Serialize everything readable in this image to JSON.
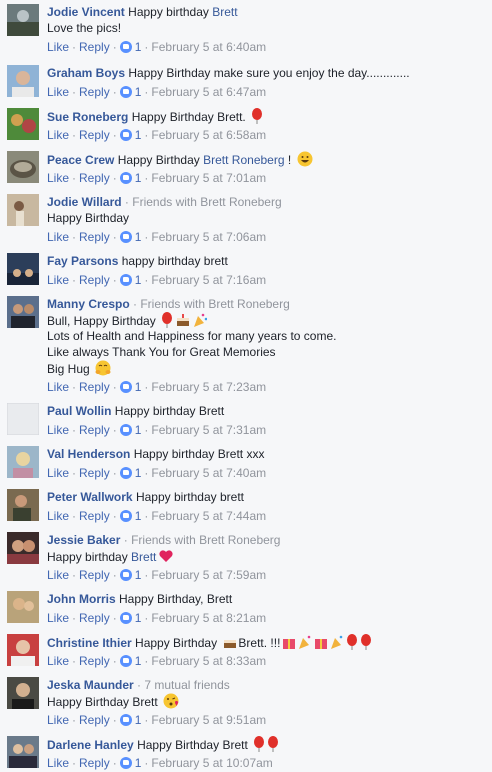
{
  "labels": {
    "like": "Like",
    "reply": "Reply",
    "separator": "·"
  },
  "colors": {
    "link": "#365899",
    "meta": "#90949c",
    "background": "#f6f7f9"
  },
  "comments": [
    {
      "author": "Jodie Vincent",
      "lines": [
        "Love the pics!"
      ],
      "inline_text": "Happy birthday ",
      "inline_mention": "Brett",
      "likes": "1",
      "time": "February 5 at 6:40am"
    },
    {
      "author": "Graham Boys",
      "inline_text": "Happy Birthday make sure you enjoy the day.............",
      "likes": "1",
      "time": "February 5 at 6:47am"
    },
    {
      "author": "Sue Roneberg",
      "inline_text": "Happy Birthday Brett. ",
      "emojis": [
        "balloon-emoji"
      ],
      "likes": "1",
      "time": "February 5 at 6:58am"
    },
    {
      "author": "Peace Crew",
      "inline_text": "Happy Birthday ",
      "inline_mention": "Brett Roneberg",
      "inline_suffix": " ! ",
      "emojis": [
        "grinning-emoji"
      ],
      "likes": "1",
      "time": "February 5 at 7:01am"
    },
    {
      "author": "Jodie Willard",
      "meta": " · Friends with Brett Roneberg",
      "lines": [
        "Happy Birthday"
      ],
      "likes": "1",
      "time": "February 5 at 7:06am"
    },
    {
      "author": "Fay Parsons",
      "inline_text": "happy birthday brett",
      "likes": "1",
      "time": "February 5 at 7:16am"
    },
    {
      "author": "Manny Crespo",
      "meta": " · Friends with Brett Roneberg",
      "lines": [
        "Bull, Happy Birthday ",
        "Lots of Health and Happiness for many years to come.",
        "Like always Thank You for Great Memories",
        "Big Hug "
      ],
      "likes": "1",
      "time": "February 5 at 7:23am"
    },
    {
      "author": "Paul Wollin",
      "inline_text": "Happy birthday Brett",
      "likes": "1",
      "time": "February 5 at 7:31am"
    },
    {
      "author": "Val Henderson",
      "inline_text": "Happy birthday Brett xxx",
      "likes": "1",
      "time": "February 5 at 7:40am"
    },
    {
      "author": "Peter Wallwork",
      "inline_text": "Happy birthday brett",
      "likes": "1",
      "time": "February 5 at 7:44am"
    },
    {
      "author": "Jessie Baker",
      "meta": " · Friends with Brett Roneberg",
      "lines": [
        "Happy birthday "
      ],
      "line_mention": "Brett",
      "likes": "1",
      "time": "February 5 at 7:59am"
    },
    {
      "author": "John Morris",
      "inline_text": "Happy Birthday, Brett",
      "likes": "1",
      "time": "February 5 at 8:21am"
    },
    {
      "author": "Christine Ithier",
      "inline_text": "Happy Birthday ",
      "inline_suffix": "Brett. !!!",
      "likes": "1",
      "time": "February 5 at 8:33am"
    },
    {
      "author": "Jeska Maunder",
      "meta": " · 7 mutual friends",
      "lines": [
        "Happy Birthday Brett "
      ],
      "likes": "1",
      "time": "February 5 at 9:51am"
    },
    {
      "author": "Darlene Hanley",
      "inline_text": "Happy Birthday Brett ",
      "likes": "1",
      "time": "February 5 at 10:07am"
    }
  ]
}
